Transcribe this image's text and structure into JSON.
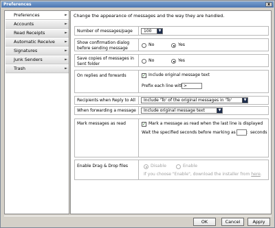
{
  "window": {
    "title": "Preferences",
    "close_label": "x"
  },
  "sidebar": {
    "items": [
      {
        "label": "Preferences",
        "active": true
      },
      {
        "label": "Accounts"
      },
      {
        "label": "Read Receipts"
      },
      {
        "label": "Automatic Receive"
      },
      {
        "label": "Signatures"
      },
      {
        "label": "Junk Senders"
      },
      {
        "label": "Trash"
      }
    ],
    "arrow": "►"
  },
  "content": {
    "header": "Change the appearance of messages and the way they are handled.",
    "messages_per_page": {
      "label": "Number of messages/page",
      "value": "100"
    },
    "confirm_dialog": {
      "label": "Show confirmation dialog before sending message",
      "no": "No",
      "yes": "Yes",
      "selected": "Yes"
    },
    "save_copies": {
      "label": "Save copies of messages in Sent folder",
      "no": "No",
      "yes": "Yes",
      "selected": "Yes"
    },
    "replies": {
      "label": "On replies and forwards",
      "include_label": "Include original message text",
      "prefix_label": "Prefix each line with:",
      "prefix_value": ">"
    },
    "reply_to_all": {
      "label": "Recipients when Reply to All",
      "value": "Include 'To' of the original messages in 'To'"
    },
    "forwarding": {
      "label": "When forwarding a message",
      "value": "Include original message text"
    },
    "mark_read": {
      "label": "Mark messages as read",
      "check_label": "Mark a message as read when the last line is displayed",
      "wait_label": "Wait the specified seconds before marking as read:",
      "wait_value": "",
      "seconds_label": "seconds"
    },
    "drag_drop": {
      "label": "Enable Drag & Drop files",
      "disable": "Disable",
      "enable": "Enable",
      "hint_prefix": "If you choose \"Enable\", download the installer from",
      "hint_link": "here",
      "hint_suffix": "."
    }
  },
  "buttons": {
    "ok": "OK",
    "cancel": "Cancel",
    "apply": "Apply"
  },
  "icons": {
    "dropdown": "▼",
    "check": "✓"
  }
}
